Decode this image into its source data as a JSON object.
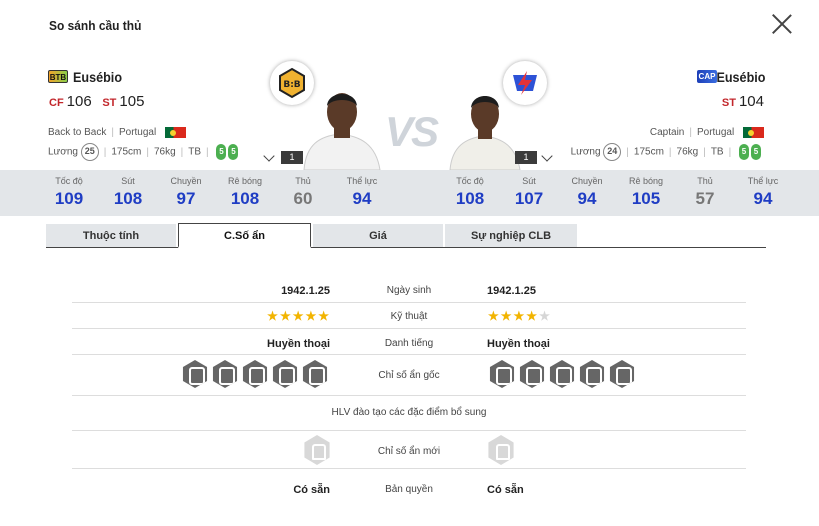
{
  "dialog": {
    "title": "So sánh cầu thủ"
  },
  "vs_label": "VS",
  "left": {
    "badge": "BTB",
    "name": "Eusébio",
    "pos1": "CF",
    "val1": "106",
    "pos2": "ST",
    "val2": "105",
    "season": "Back to Back",
    "nation": "Portugal",
    "wage_label": "Lương",
    "wage": "25",
    "height": "175cm",
    "weight": "76kg",
    "body": "TB",
    "foot_l": "5",
    "foot_r": "5",
    "level": "1",
    "stats": [
      {
        "l": "Tốc độ",
        "v": "109"
      },
      {
        "l": "Sút",
        "v": "108"
      },
      {
        "l": "Chuyền",
        "v": "97"
      },
      {
        "l": "Rê bóng",
        "v": "108"
      },
      {
        "l": "Thủ",
        "v": "60"
      },
      {
        "l": "Thể lực",
        "v": "94"
      }
    ],
    "birth": "1942.1.25",
    "skill_stars": 5,
    "reputation": "Huyền thoại",
    "license": "Có sẵn"
  },
  "right": {
    "badge": "CAP",
    "name": "Eusébio",
    "pos1": "ST",
    "val1": "104",
    "season": "Captain",
    "nation": "Portugal",
    "wage_label": "Lương",
    "wage": "24",
    "height": "175cm",
    "weight": "76kg",
    "body": "TB",
    "foot_l": "5",
    "foot_r": "5",
    "level": "1",
    "stats": [
      {
        "l": "Tốc độ",
        "v": "108"
      },
      {
        "l": "Sút",
        "v": "107"
      },
      {
        "l": "Chuyền",
        "v": "94"
      },
      {
        "l": "Rê bóng",
        "v": "105"
      },
      {
        "l": "Thủ",
        "v": "57"
      },
      {
        "l": "Thể lực",
        "v": "94"
      }
    ],
    "birth": "1942.1.25",
    "skill_stars": 4,
    "reputation": "Huyền thoại",
    "license": "Có sẵn"
  },
  "tabs": [
    "Thuộc tính",
    "C.Số ẩn",
    "Giá",
    "Sự nghiệp CLB"
  ],
  "active_tab": "C.Số ẩn",
  "rows": {
    "birth": "Ngày sinh",
    "skill": "Kỹ thuật",
    "reputation": "Danh tiếng",
    "traits": "Chỉ số ẩn gốc",
    "coach": "HLV đào tạo các đặc điểm bổ sung",
    "new_traits": "Chỉ số ẩn mới",
    "license": "Bản quyền"
  },
  "colors": {
    "high": "#1f3dc4",
    "mid": "#1f3dc4",
    "low": "#777777",
    "accent": "#c2262b"
  },
  "icons": {
    "close": "close-icon",
    "lock": "lock-icon",
    "trait": "trait-icon"
  }
}
